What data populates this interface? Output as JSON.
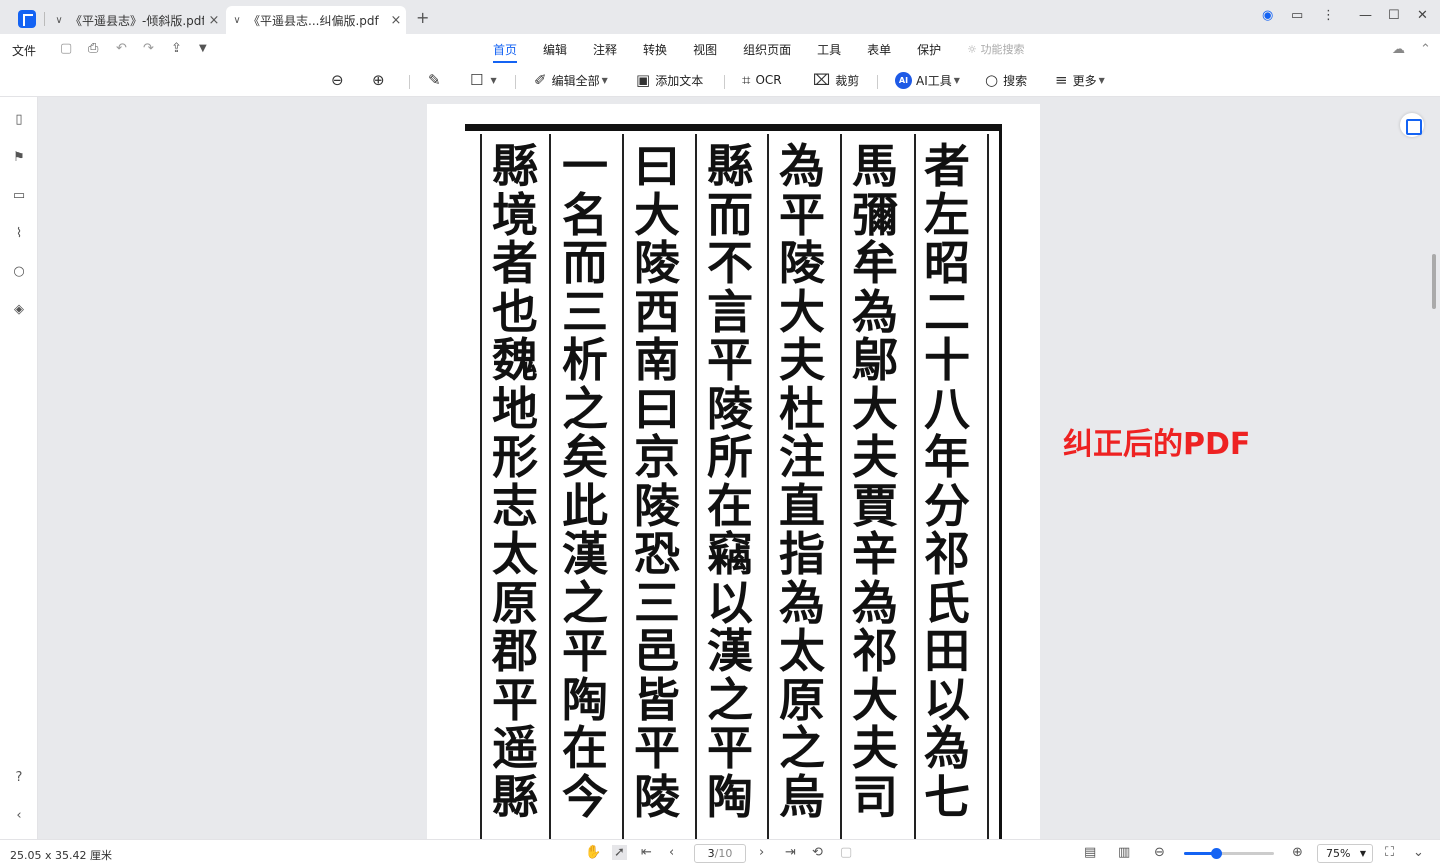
{
  "tabs": [
    {
      "label": "《平遥县志》-倾斜版.pdf"
    },
    {
      "label": "《平遥县志...纠偏版.pdf"
    }
  ],
  "menubar": {
    "file": "文件",
    "tabs": [
      "首页",
      "编辑",
      "注释",
      "转换",
      "视图",
      "组织页面",
      "工具",
      "表单",
      "保护"
    ],
    "feature_search": "功能搜索"
  },
  "toolbar": {
    "edit_all": "编辑全部",
    "add_text": "添加文本",
    "ocr": "OCR",
    "crop": "裁剪",
    "ai_badge": "AI",
    "ai_tools": "AI工具",
    "search": "搜索",
    "more": "更多"
  },
  "document": {
    "columns": [
      "者左昭二十八年分祁氏田以為七",
      "馬彌牟為鄔大夫賈辛為祁大夫司",
      "為平陵大夫杜注直指為太原之烏",
      "縣而不言平陵所在竊以漢之平陶",
      "曰大陵西南曰京陵恐三邑皆平陵",
      "一名而三析之矣此漢之平陶在今",
      "縣境者也魏地形志太原郡平遥縣"
    ]
  },
  "annotation": "纠正后的PDF",
  "status": {
    "dimensions": "25.05 x 35.42 厘米",
    "current_page": "3",
    "total_pages": "/10",
    "zoom": "75%",
    "zoom_fraction": 0.35
  },
  "colors": {
    "accent": "#1463f3",
    "annotation": "#ee2222"
  }
}
